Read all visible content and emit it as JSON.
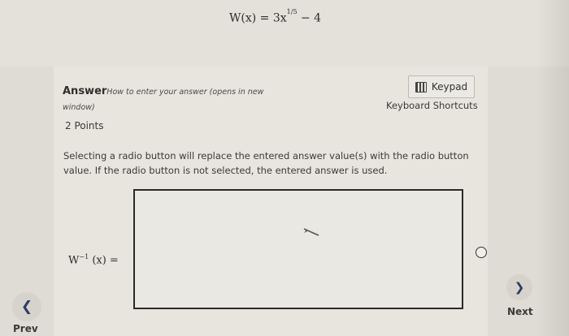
{
  "question": {
    "formula_text": "W(x) = 3x",
    "formula_exponent": "1/5",
    "formula_tail": "− 4"
  },
  "answer": {
    "title": "Answer",
    "help_link": "How to enter your answer (opens in new window)",
    "keypad_label": "Keypad",
    "shortcuts_label": "Keyboard Shortcuts",
    "points": "2 Points",
    "instructions": "Selecting a radio button will replace the entered answer value(s) with the radio button value. If the radio button is not selected, the entered answer is used.",
    "field_label_base": "W",
    "field_label_exp": "−1",
    "field_label_tail": "(x) ="
  },
  "nav": {
    "prev_label": "Prev",
    "next_label": "Next",
    "prev_icon": "chevron-left-icon",
    "next_icon": "chevron-right-icon"
  },
  "colors": {
    "nav_icon": "#2f3a66",
    "background": "#dfdcd5"
  }
}
